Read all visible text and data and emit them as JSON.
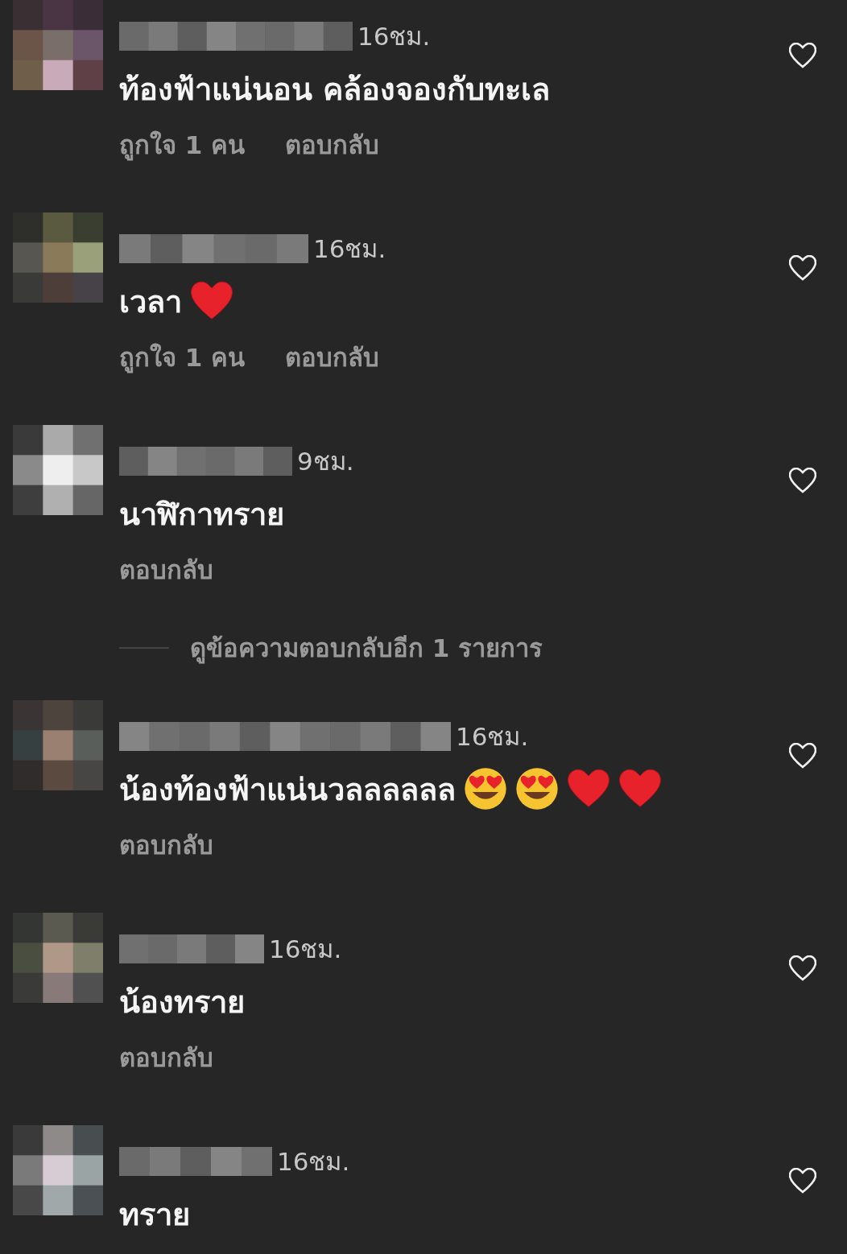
{
  "comments": [
    {
      "time": "16ชม.",
      "text": "ท้องฟ้าแน่นอน คล้องจองกับทะเล",
      "likes": "ถูกใจ 1 คน",
      "reply": "ตอบกลับ",
      "liked": false
    },
    {
      "time": "16ชม.",
      "text": "เวลา",
      "emojis": [
        {
          "kind": "heart"
        }
      ],
      "likes": "ถูกใจ 1 คน",
      "reply": "ตอบกลับ",
      "liked": false
    },
    {
      "time": "9ชม.",
      "text": "นาฬิกาทราย",
      "reply": "ตอบกลับ",
      "more_replies": "ดูข้อความตอบกลับอีก 1 รายการ",
      "liked": false
    },
    {
      "time": "16ชม.",
      "text": "น้องท้องฟ้าแน่นวลลลลลล",
      "emojis": [
        {
          "kind": "heart_eyes"
        },
        {
          "kind": "heart_eyes"
        },
        {
          "kind": "heart"
        },
        {
          "kind": "heart"
        }
      ],
      "reply": "ตอบกลับ",
      "liked": false
    },
    {
      "time": "16ชม.",
      "text": "น้องทราย",
      "reply": "ตอบกลับ",
      "liked": false
    },
    {
      "time": "16ชม.",
      "text": "ทราย",
      "liked": false
    }
  ]
}
